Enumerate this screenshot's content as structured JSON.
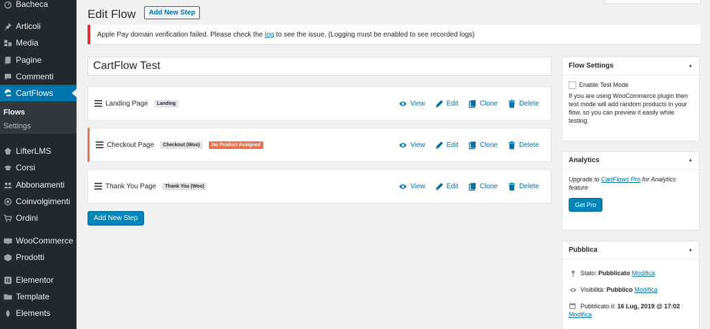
{
  "sidebar": {
    "items": [
      {
        "label": "Bacheca",
        "icon": "dashboard-icon"
      },
      {
        "label": "Articoli",
        "icon": "pin-icon"
      },
      {
        "label": "Media",
        "icon": "media-icon"
      },
      {
        "label": "Pagine",
        "icon": "pages-icon"
      },
      {
        "label": "Commenti",
        "icon": "comments-icon"
      },
      {
        "label": "CartFlows",
        "icon": "cartflows-icon"
      },
      {
        "label": "LifterLMS",
        "icon": "lifterlms-icon"
      },
      {
        "label": "Corsi",
        "icon": "graduation-cap-icon"
      },
      {
        "label": "Abbonamenti",
        "icon": "group-icon"
      },
      {
        "label": "Coinvolgimenti",
        "icon": "engagement-icon"
      },
      {
        "label": "Ordini",
        "icon": "cart-icon"
      },
      {
        "label": "WooCommerce",
        "icon": "woocommerce-icon"
      },
      {
        "label": "Prodotti",
        "icon": "products-icon"
      },
      {
        "label": "Elementor",
        "icon": "elementor-icon"
      },
      {
        "label": "Template",
        "icon": "folder-icon"
      },
      {
        "label": "Elements",
        "icon": "elements-icon"
      }
    ],
    "submenu": [
      "Flows",
      "Settings"
    ]
  },
  "header": {
    "title": "Edit Flow",
    "add_step_label": "Add New Step"
  },
  "notice": {
    "before": "Apple Pay domain verification failed. Please check the",
    "link": "log",
    "after": "to see the issue. (Logging must be enabled to see recorded logs)"
  },
  "flow_title": "CartFlow Test",
  "steps": [
    {
      "title": "Landing Page",
      "badge": "Landing",
      "warning": ""
    },
    {
      "title": "Checkout Page",
      "badge": "Checkout (Woo)",
      "warning": "No Product Assigned"
    },
    {
      "title": "Thank You Page",
      "badge": "Thank You (Woo)",
      "warning": ""
    }
  ],
  "actions": {
    "view": "View",
    "edit": "Edit",
    "clone": "Clone",
    "delete": "Delete"
  },
  "add_step_bottom": "Add New Step",
  "flow_settings": {
    "title": "Flow Settings",
    "checkbox_label": "Enable Test Mode",
    "description": "If you are using WooCommerce plugin then test mode will add random products in your flow, so you can preview it easily while testing."
  },
  "analytics": {
    "title": "Analytics",
    "text_before": "Upgrade to",
    "link": "CartFlows Pro",
    "text_after": "for Analytics feature",
    "button": "Get Pro"
  },
  "publish": {
    "title": "Pubblica",
    "status_label": "Stato:",
    "status_value": "Pubblicato",
    "visibility_label": "Visibilità:",
    "visibility_value": "Pubblico",
    "published_label": "Pubblicato il:",
    "published_value": "16 Lug, 2019 @ 17:02",
    "edit_link": "Modifica"
  },
  "colors": {
    "sidebar_bg": "#23282d",
    "accent": "#0073aa",
    "notice_error": "#dc3232",
    "warning_badge": "#e9724c"
  }
}
